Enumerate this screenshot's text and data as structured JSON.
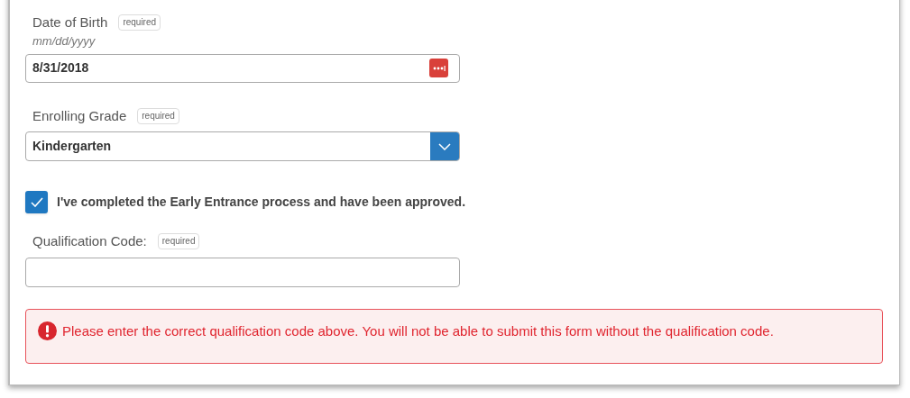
{
  "date_of_birth": {
    "label": "Date of Birth",
    "badge": "required",
    "hint": "mm/dd/yyyy",
    "value": "8/31/2018"
  },
  "enrolling_grade": {
    "label": "Enrolling Grade",
    "badge": "required",
    "value": "Kindergarten"
  },
  "early_entrance": {
    "label": "I've completed the Early Entrance process and have been approved.",
    "checked": true
  },
  "qualification_code": {
    "label": "Qualification Code:",
    "badge": "required"
  },
  "error": {
    "message": "Please enter the correct qualification code above. You will not be able to submit this form without the qualification code."
  }
}
